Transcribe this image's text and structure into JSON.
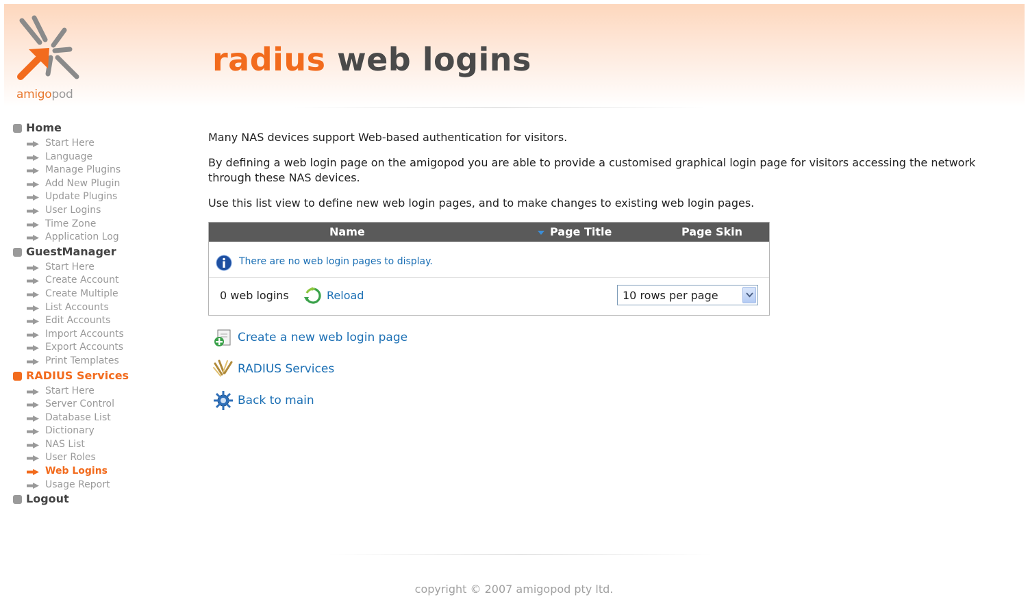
{
  "brand": {
    "logo_text_orange": "amigo",
    "logo_text_gray": "pod",
    "accent_color": "#f26b1d"
  },
  "header": {
    "title_part1": "radius",
    "title_part2": "web logins"
  },
  "sidebar": {
    "sections": [
      {
        "label": "Home",
        "active": false,
        "items": [
          "Start Here",
          "Language",
          "Manage Plugins",
          "Add New Plugin",
          "Update Plugins",
          "User Logins",
          "Time Zone",
          "Application Log"
        ]
      },
      {
        "label": "GuestManager",
        "active": false,
        "items": [
          "Start Here",
          "Create Account",
          "Create Multiple",
          "List Accounts",
          "Edit Accounts",
          "Import Accounts",
          "Export Accounts",
          "Print Templates"
        ]
      },
      {
        "label": "RADIUS Services",
        "active": true,
        "items": [
          "Start Here",
          "Server Control",
          "Database List",
          "Dictionary",
          "NAS List",
          "User Roles",
          "Web Logins",
          "Usage Report"
        ],
        "active_item": "Web Logins"
      },
      {
        "label": "Logout",
        "active": false,
        "items": []
      }
    ]
  },
  "main": {
    "intro": "Many NAS devices support Web-based authentication for visitors.",
    "para2": "By defining a web login page on the amigopod you are able to provide a customised graphical login page for visitors accessing the network through these NAS devices.",
    "para3": "Use this list view to define new web login pages, and to make changes to existing web login pages."
  },
  "list": {
    "columns": [
      "Name",
      "Page Title",
      "Page Skin"
    ],
    "empty_message": "There are no web login pages to display.",
    "count_label": "0 web logins",
    "reload_label": "Reload",
    "rows_per_page": "10 rows per page"
  },
  "actions": {
    "create": "Create a new web login page",
    "radius": "RADIUS Services",
    "back": "Back to main"
  },
  "footer": {
    "copyright": "copyright © 2007 amigopod pty ltd."
  }
}
